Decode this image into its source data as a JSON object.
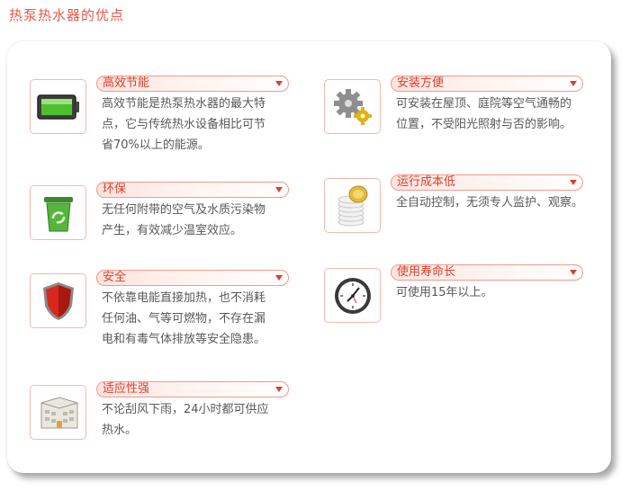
{
  "title": "热泵热水器的优点",
  "features_left": [
    {
      "label": "高效节能",
      "icon": "battery-icon",
      "lines": [
        "高效节能是热泵热水器的最大特",
        "点，它与传统热水设备相比可节",
        "省70%以上的能源。"
      ]
    },
    {
      "label": "环保",
      "icon": "recycle-bin-icon",
      "lines": [
        "无任何附带的空气及水质污染物",
        "产生，有效减少温室效应。"
      ]
    },
    {
      "label": "安全",
      "icon": "shield-icon",
      "lines": [
        "不依靠电能直接加热，也不消耗",
        "任何油、气等可燃物，不存在漏",
        "电和有毒气体排放等安全隐患。"
      ]
    },
    {
      "label": "适应性强",
      "icon": "building-icon",
      "lines": [
        "不论刮风下雨，24小时都可供应",
        "热水。"
      ]
    }
  ],
  "features_right": [
    {
      "label": "安装方便",
      "icon": "gears-icon",
      "lines": [
        "可安装在屋顶、庭院等空气通畅的",
        "位置，不受阳光照射与否的影响。"
      ]
    },
    {
      "label": "运行成本低",
      "icon": "coins-icon",
      "lines": [
        "全自动控制，无须专人监护、观察。"
      ]
    },
    {
      "label": "使用寿命长",
      "icon": "clock-icon",
      "lines": [
        "可使用15年以上。"
      ]
    }
  ]
}
